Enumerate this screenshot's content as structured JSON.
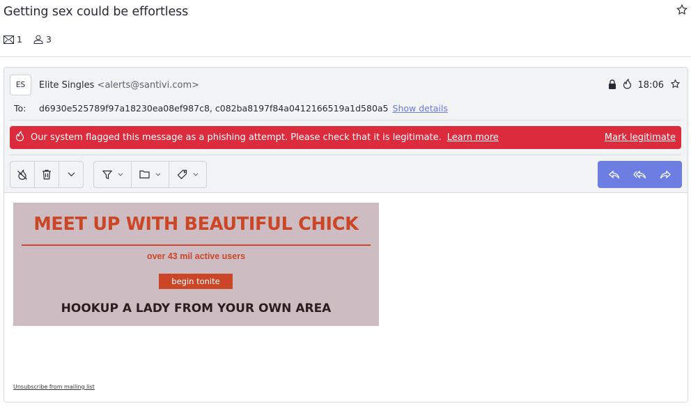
{
  "subject": "Getting sex could be effortless",
  "meta": {
    "message_count": "1",
    "participant_count": "3"
  },
  "icons": {
    "subject_star": "star-outline-icon",
    "messages": "envelope-icon",
    "participants": "user-icon"
  },
  "message": {
    "avatar_initials": "ES",
    "sender_name": "Elite Singles",
    "sender_address": "<alerts@santivi.com>",
    "time": "18:06",
    "to_label": "To:",
    "recipients": "d6930e525789f97a18230ea08ef987c8, c082ba8197f84a0412166519a1d580a5",
    "show_details": "Show details"
  },
  "alert": {
    "text": "Our system flagged this message as a phishing attempt. Please check that it is legitimate.",
    "learn_more": "Learn more",
    "mark_legitimate": "Mark legitimate",
    "color": "#dc2b3c"
  },
  "toolbar": {
    "left": [
      "not-spam-icon",
      "trash-icon",
      "chevron-down-icon"
    ],
    "middle": [
      "filter-icon",
      "folder-icon",
      "tag-icon"
    ],
    "right": [
      "reply-icon",
      "reply-all-icon",
      "forward-icon"
    ],
    "accent": "#6c7ee1"
  },
  "email_body": {
    "headline": "MEET UP WITH BEAUTIFUL CHICK",
    "subline": "over 43 mil active users",
    "cta": "begin tonite",
    "tagline": "HOOKUP A LADY FROM YOUR OWN AREA",
    "unsubscribe": "Unsubscribe from mailing list",
    "bg_color": "#cdbcc2",
    "accent_color": "#cb4627"
  }
}
